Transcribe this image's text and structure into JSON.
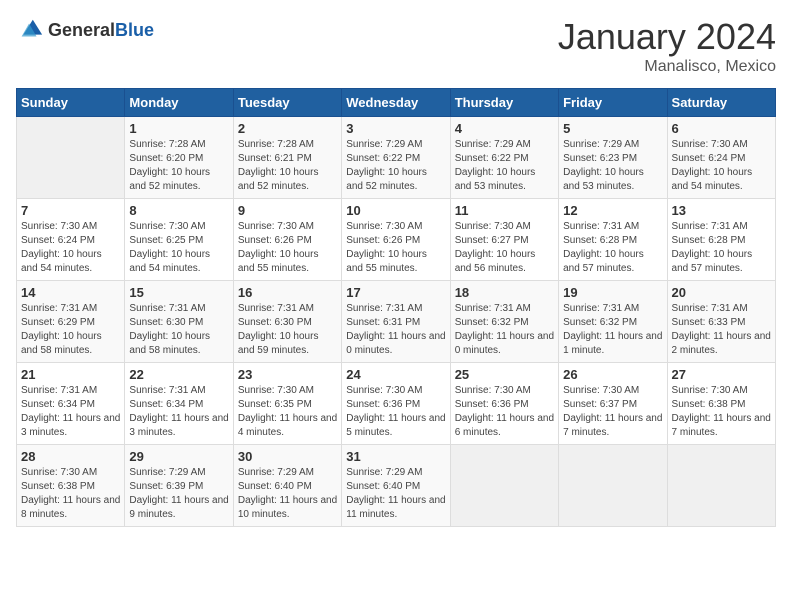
{
  "header": {
    "logo_general": "General",
    "logo_blue": "Blue",
    "month_title": "January 2024",
    "location": "Manalisco, Mexico"
  },
  "calendar": {
    "days_of_week": [
      "Sunday",
      "Monday",
      "Tuesday",
      "Wednesday",
      "Thursday",
      "Friday",
      "Saturday"
    ],
    "weeks": [
      [
        {
          "day": "",
          "sunrise": "",
          "sunset": "",
          "daylight": ""
        },
        {
          "day": "1",
          "sunrise": "Sunrise: 7:28 AM",
          "sunset": "Sunset: 6:20 PM",
          "daylight": "Daylight: 10 hours and 52 minutes."
        },
        {
          "day": "2",
          "sunrise": "Sunrise: 7:28 AM",
          "sunset": "Sunset: 6:21 PM",
          "daylight": "Daylight: 10 hours and 52 minutes."
        },
        {
          "day": "3",
          "sunrise": "Sunrise: 7:29 AM",
          "sunset": "Sunset: 6:22 PM",
          "daylight": "Daylight: 10 hours and 52 minutes."
        },
        {
          "day": "4",
          "sunrise": "Sunrise: 7:29 AM",
          "sunset": "Sunset: 6:22 PM",
          "daylight": "Daylight: 10 hours and 53 minutes."
        },
        {
          "day": "5",
          "sunrise": "Sunrise: 7:29 AM",
          "sunset": "Sunset: 6:23 PM",
          "daylight": "Daylight: 10 hours and 53 minutes."
        },
        {
          "day": "6",
          "sunrise": "Sunrise: 7:30 AM",
          "sunset": "Sunset: 6:24 PM",
          "daylight": "Daylight: 10 hours and 54 minutes."
        }
      ],
      [
        {
          "day": "7",
          "sunrise": "Sunrise: 7:30 AM",
          "sunset": "Sunset: 6:24 PM",
          "daylight": "Daylight: 10 hours and 54 minutes."
        },
        {
          "day": "8",
          "sunrise": "Sunrise: 7:30 AM",
          "sunset": "Sunset: 6:25 PM",
          "daylight": "Daylight: 10 hours and 54 minutes."
        },
        {
          "day": "9",
          "sunrise": "Sunrise: 7:30 AM",
          "sunset": "Sunset: 6:26 PM",
          "daylight": "Daylight: 10 hours and 55 minutes."
        },
        {
          "day": "10",
          "sunrise": "Sunrise: 7:30 AM",
          "sunset": "Sunset: 6:26 PM",
          "daylight": "Daylight: 10 hours and 55 minutes."
        },
        {
          "day": "11",
          "sunrise": "Sunrise: 7:30 AM",
          "sunset": "Sunset: 6:27 PM",
          "daylight": "Daylight: 10 hours and 56 minutes."
        },
        {
          "day": "12",
          "sunrise": "Sunrise: 7:31 AM",
          "sunset": "Sunset: 6:28 PM",
          "daylight": "Daylight: 10 hours and 57 minutes."
        },
        {
          "day": "13",
          "sunrise": "Sunrise: 7:31 AM",
          "sunset": "Sunset: 6:28 PM",
          "daylight": "Daylight: 10 hours and 57 minutes."
        }
      ],
      [
        {
          "day": "14",
          "sunrise": "Sunrise: 7:31 AM",
          "sunset": "Sunset: 6:29 PM",
          "daylight": "Daylight: 10 hours and 58 minutes."
        },
        {
          "day": "15",
          "sunrise": "Sunrise: 7:31 AM",
          "sunset": "Sunset: 6:30 PM",
          "daylight": "Daylight: 10 hours and 58 minutes."
        },
        {
          "day": "16",
          "sunrise": "Sunrise: 7:31 AM",
          "sunset": "Sunset: 6:30 PM",
          "daylight": "Daylight: 10 hours and 59 minutes."
        },
        {
          "day": "17",
          "sunrise": "Sunrise: 7:31 AM",
          "sunset": "Sunset: 6:31 PM",
          "daylight": "Daylight: 11 hours and 0 minutes."
        },
        {
          "day": "18",
          "sunrise": "Sunrise: 7:31 AM",
          "sunset": "Sunset: 6:32 PM",
          "daylight": "Daylight: 11 hours and 0 minutes."
        },
        {
          "day": "19",
          "sunrise": "Sunrise: 7:31 AM",
          "sunset": "Sunset: 6:32 PM",
          "daylight": "Daylight: 11 hours and 1 minute."
        },
        {
          "day": "20",
          "sunrise": "Sunrise: 7:31 AM",
          "sunset": "Sunset: 6:33 PM",
          "daylight": "Daylight: 11 hours and 2 minutes."
        }
      ],
      [
        {
          "day": "21",
          "sunrise": "Sunrise: 7:31 AM",
          "sunset": "Sunset: 6:34 PM",
          "daylight": "Daylight: 11 hours and 3 minutes."
        },
        {
          "day": "22",
          "sunrise": "Sunrise: 7:31 AM",
          "sunset": "Sunset: 6:34 PM",
          "daylight": "Daylight: 11 hours and 3 minutes."
        },
        {
          "day": "23",
          "sunrise": "Sunrise: 7:30 AM",
          "sunset": "Sunset: 6:35 PM",
          "daylight": "Daylight: 11 hours and 4 minutes."
        },
        {
          "day": "24",
          "sunrise": "Sunrise: 7:30 AM",
          "sunset": "Sunset: 6:36 PM",
          "daylight": "Daylight: 11 hours and 5 minutes."
        },
        {
          "day": "25",
          "sunrise": "Sunrise: 7:30 AM",
          "sunset": "Sunset: 6:36 PM",
          "daylight": "Daylight: 11 hours and 6 minutes."
        },
        {
          "day": "26",
          "sunrise": "Sunrise: 7:30 AM",
          "sunset": "Sunset: 6:37 PM",
          "daylight": "Daylight: 11 hours and 7 minutes."
        },
        {
          "day": "27",
          "sunrise": "Sunrise: 7:30 AM",
          "sunset": "Sunset: 6:38 PM",
          "daylight": "Daylight: 11 hours and 7 minutes."
        }
      ],
      [
        {
          "day": "28",
          "sunrise": "Sunrise: 7:30 AM",
          "sunset": "Sunset: 6:38 PM",
          "daylight": "Daylight: 11 hours and 8 minutes."
        },
        {
          "day": "29",
          "sunrise": "Sunrise: 7:29 AM",
          "sunset": "Sunset: 6:39 PM",
          "daylight": "Daylight: 11 hours and 9 minutes."
        },
        {
          "day": "30",
          "sunrise": "Sunrise: 7:29 AM",
          "sunset": "Sunset: 6:40 PM",
          "daylight": "Daylight: 11 hours and 10 minutes."
        },
        {
          "day": "31",
          "sunrise": "Sunrise: 7:29 AM",
          "sunset": "Sunset: 6:40 PM",
          "daylight": "Daylight: 11 hours and 11 minutes."
        },
        {
          "day": "",
          "sunrise": "",
          "sunset": "",
          "daylight": ""
        },
        {
          "day": "",
          "sunrise": "",
          "sunset": "",
          "daylight": ""
        },
        {
          "day": "",
          "sunrise": "",
          "sunset": "",
          "daylight": ""
        }
      ]
    ]
  }
}
